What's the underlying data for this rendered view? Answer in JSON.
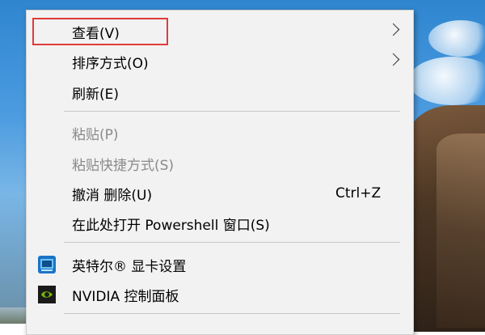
{
  "menu": {
    "items": [
      {
        "label": "查看(V)",
        "submenu": true
      },
      {
        "label": "排序方式(O)",
        "submenu": true
      },
      {
        "label": "刷新(E)"
      },
      {
        "label": "粘贴(P)",
        "disabled": true
      },
      {
        "label": "粘贴快捷方式(S)",
        "disabled": true
      },
      {
        "label": "撤消 删除(U)",
        "shortcut": "Ctrl+Z"
      },
      {
        "label": "在此处打开 Powershell 窗口(S)"
      },
      {
        "label": "英特尔® 显卡设置",
        "icon": "intel-graphics-icon"
      },
      {
        "label": "NVIDIA 控制面板",
        "icon": "nvidia-icon"
      }
    ]
  },
  "colors": {
    "menu_bg": "#f2f2f2",
    "disabled_text": "#8a8a8a",
    "highlight_border": "#e03a3a",
    "separator": "#c8c8c8"
  }
}
